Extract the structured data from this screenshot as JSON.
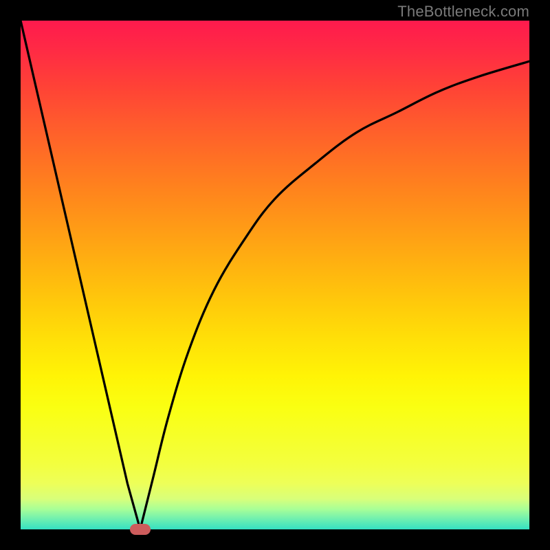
{
  "attribution": "TheBottleneck.com",
  "colors": {
    "frame": "#000000",
    "curve": "#000000",
    "marker": "#cd5c5c",
    "gradient_top": "#ff1a4d",
    "gradient_bottom": "#34e0c2"
  },
  "chart_data": {
    "type": "line",
    "title": "",
    "xlabel": "",
    "ylabel": "",
    "xlim": [
      0,
      100
    ],
    "ylim": [
      0,
      100
    ],
    "grid": false,
    "legend": false,
    "series": [
      {
        "name": "left-branch",
        "x": [
          0,
          3,
          6,
          9,
          12,
          15,
          18,
          21,
          23.5
        ],
        "y": [
          100,
          87,
          74,
          61,
          48,
          35,
          22,
          9,
          0
        ]
      },
      {
        "name": "right-branch",
        "x": [
          23.5,
          26,
          29,
          33,
          38,
          44,
          50,
          58,
          66,
          74,
          82,
          90,
          100
        ],
        "y": [
          0,
          10,
          22,
          35,
          47,
          57,
          65,
          72,
          78,
          82,
          86,
          89,
          92
        ]
      }
    ],
    "annotations": [
      {
        "name": "minimum-marker",
        "x": 23.5,
        "y": 0,
        "shape": "pill",
        "color": "#cd5c5c"
      }
    ],
    "background": "vertical-gradient red→yellow→green"
  }
}
